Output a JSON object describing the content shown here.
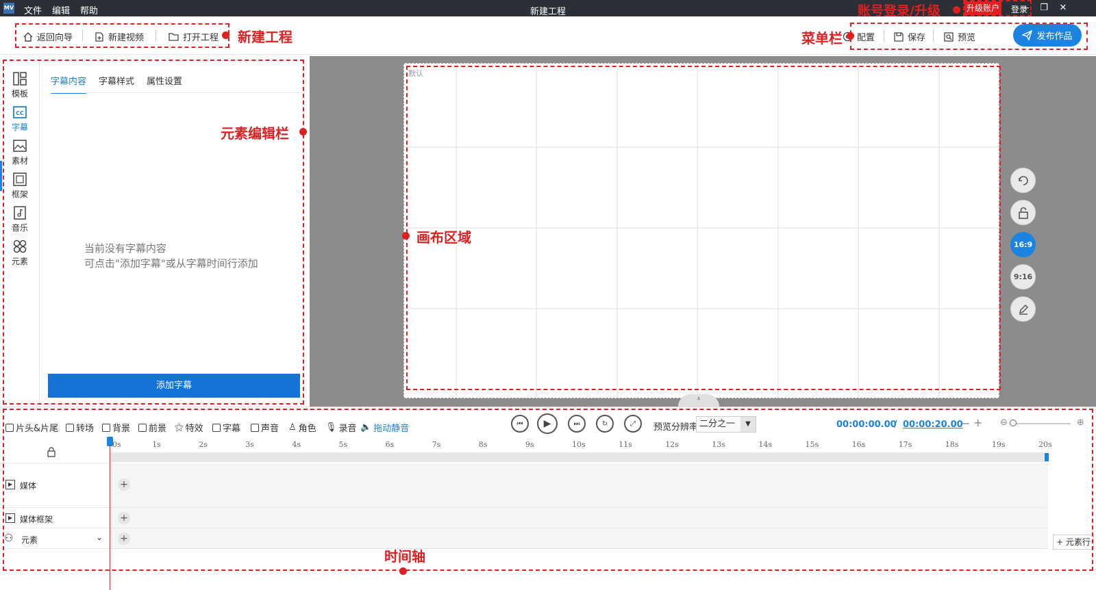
{
  "titlebar": {
    "logo": "MV",
    "menu": [
      "文件",
      "编辑",
      "帮助"
    ],
    "title": "新建工程",
    "upgrade": "升级账户",
    "login": "登录"
  },
  "toolbar": {
    "back": "返回向导",
    "new_video": "新建视频",
    "open_project": "打开工程",
    "config": "配置",
    "save": "保存",
    "preview": "预览",
    "publish": "发布作品"
  },
  "annotations": {
    "new_project": "新建工程",
    "menu_bar": "菜单栏",
    "account": "账号登录/升级",
    "element_editor": "元素编辑栏",
    "canvas": "画布区域",
    "timeline": "时间轴"
  },
  "sidebar": {
    "items": [
      {
        "label": "模板",
        "icon": "template-icon"
      },
      {
        "label": "字幕",
        "icon": "subtitle-icon"
      },
      {
        "label": "素材",
        "icon": "image-icon"
      },
      {
        "label": "框架",
        "icon": "frame-icon"
      },
      {
        "label": "音乐",
        "icon": "music-icon"
      },
      {
        "label": "元素",
        "icon": "elements-icon"
      }
    ],
    "active": "字幕"
  },
  "editor": {
    "tabs": [
      "字幕内容",
      "字幕样式",
      "属性设置"
    ],
    "empty_line1": "当前没有字幕内容",
    "empty_line2": "可点击\"添加字幕\"或从字幕时间行添加",
    "add_button": "添加字幕"
  },
  "canvas": {
    "label": "默认",
    "ratios": [
      "16:9",
      "9:16"
    ],
    "active_ratio": "16:9"
  },
  "timeline": {
    "tools": [
      "片头&片尾",
      "转场",
      "背景",
      "前景",
      "特效",
      "字幕",
      "声音",
      "角色",
      "录音",
      "拖动静音"
    ],
    "resolution_label": "预览分辨率",
    "resolution_value": "二分之一",
    "current_time": "00:00:00.00",
    "separator": "/",
    "total_time": "00:00:20.00",
    "ticks": [
      "0s",
      "1s",
      "2s",
      "3s",
      "4s",
      "5s",
      "6s",
      "7s",
      "8s",
      "9s",
      "10s",
      "11s",
      "12s",
      "13s",
      "14s",
      "15s",
      "16s",
      "17s",
      "18s",
      "19s",
      "20s"
    ],
    "tracks": [
      "媒体",
      "媒体框架",
      "元素"
    ],
    "add_row": "+ 元素行"
  },
  "colors": {
    "accent": "#1a84e0",
    "annotation": "#e02020",
    "titlebar": "#2c2f36"
  }
}
